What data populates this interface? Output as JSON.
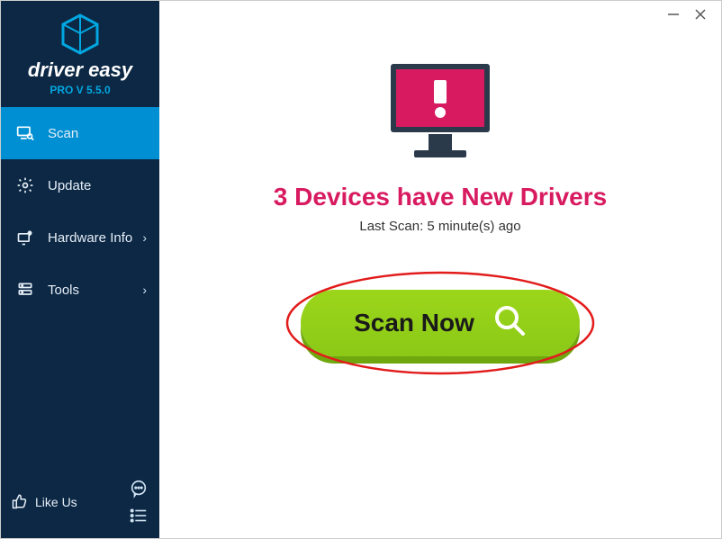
{
  "app": {
    "brand_name": "driver easy",
    "version_label": "PRO V 5.5.0"
  },
  "sidebar": {
    "items": [
      {
        "label": "Scan",
        "active": true,
        "icon": "monitor-search-icon"
      },
      {
        "label": "Update",
        "icon": "gear-icon",
        "chevron": false
      },
      {
        "label": "Hardware Info",
        "icon": "hardware-icon",
        "chevron": true
      },
      {
        "label": "Tools",
        "icon": "tools-icon",
        "chevron": true
      }
    ],
    "likeus_label": "Like Us",
    "feedback_icon": "feedback-icon",
    "menu_icon": "menu-lines-icon"
  },
  "main": {
    "headline": "3 Devices have New Drivers",
    "last_scan_text": "Last Scan: 5 minute(s) ago",
    "scan_button_label": "Scan Now"
  },
  "colors": {
    "sidebar_bg": "#0c2845",
    "active_bg": "#008fd3",
    "accent_pink": "#d81b60",
    "scan_green": "#8bc917",
    "annotation_red": "#e21b1b"
  }
}
